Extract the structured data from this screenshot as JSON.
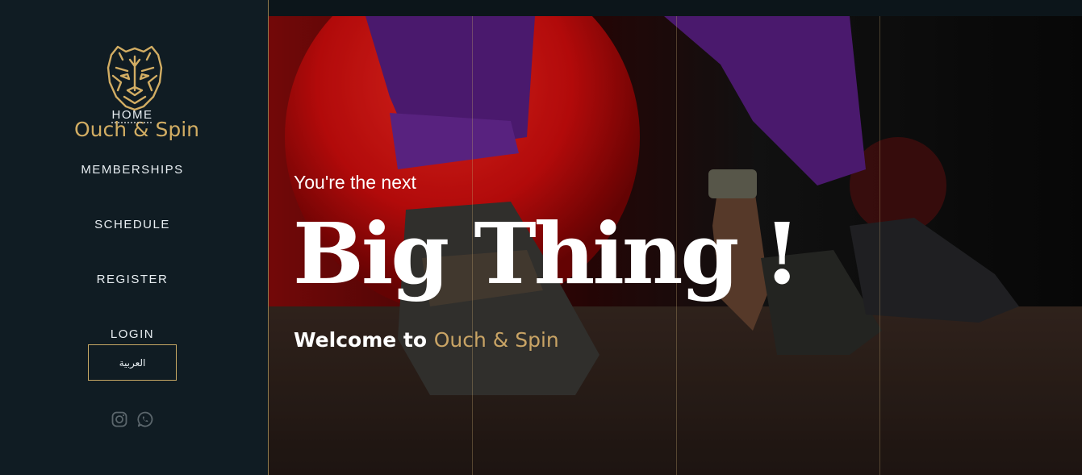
{
  "brand": {
    "name": "Ouch & Spin",
    "color": "#d2ad63"
  },
  "nav": {
    "items": [
      {
        "label": "HOME"
      },
      {
        "label": "MEMBERSHIPS"
      },
      {
        "label": "SCHEDULE"
      },
      {
        "label": "REGISTER"
      },
      {
        "label": "LOGIN"
      }
    ],
    "language_button": "العربية"
  },
  "social": [
    {
      "icon": "instagram-icon"
    },
    {
      "icon": "whatsapp-icon"
    }
  ],
  "hero": {
    "subtitle": "You're the next",
    "headline": "Big Thing !",
    "welcome_prefix": "Welcome to ",
    "welcome_brand": "Ouch & Spin"
  },
  "colors": {
    "sidebar_bg": "#101c23",
    "accent": "#c9a465",
    "text": "#ffffff"
  }
}
